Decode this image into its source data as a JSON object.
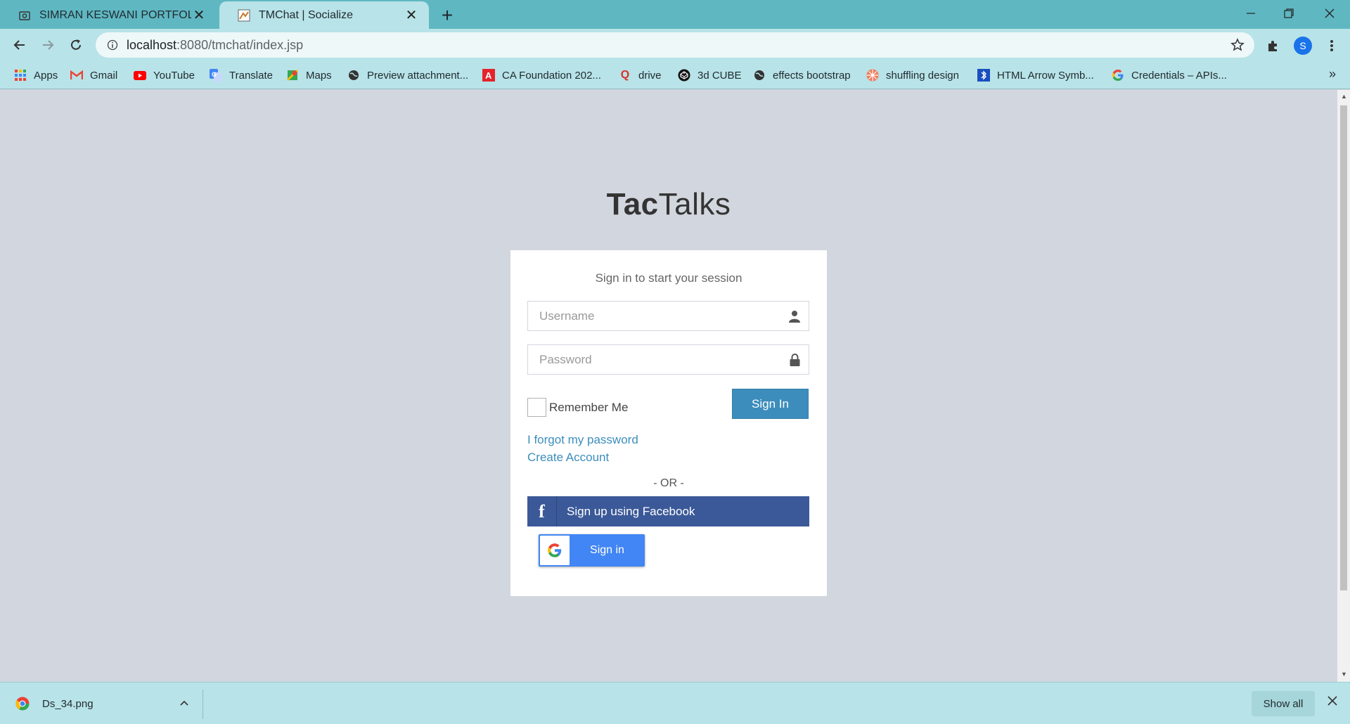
{
  "browser": {
    "tabs": [
      {
        "title": "SIMRAN KESWANI PORTFOLIO",
        "active": false
      },
      {
        "title": "TMChat | Socialize",
        "active": true
      }
    ],
    "url_host": "localhost",
    "url_rest": ":8080/tmchat/index.jsp",
    "profile_initial": "S",
    "bookmarks": [
      {
        "label": "Apps",
        "icon": "apps-grid-icon"
      },
      {
        "label": "Gmail",
        "icon": "gmail-icon"
      },
      {
        "label": "YouTube",
        "icon": "youtube-icon"
      },
      {
        "label": "Translate",
        "icon": "translate-icon"
      },
      {
        "label": "Maps",
        "icon": "maps-icon"
      },
      {
        "label": "Preview attachment...",
        "icon": "globe-icon"
      },
      {
        "label": "CA Foundation 202...",
        "icon": "acrobat-icon"
      },
      {
        "label": "drive",
        "icon": "q-icon"
      },
      {
        "label": "3d CUBE",
        "icon": "codepen-icon"
      },
      {
        "label": "effects bootstrap",
        "icon": "globe-icon"
      },
      {
        "label": "shuffling design",
        "icon": "pinwheel-icon"
      },
      {
        "label": "HTML Arrow Symb...",
        "icon": "bluetooth-icon"
      },
      {
        "label": "Credentials – APIs...",
        "icon": "google-icon"
      }
    ],
    "bookmarks_more": "»"
  },
  "login": {
    "logo_bold": "Tac",
    "logo_light": "Talks",
    "message": "Sign in to start your session",
    "username_placeholder": "Username",
    "password_placeholder": "Password",
    "remember_label": "Remember Me",
    "signin_label": "Sign In",
    "forgot_label": "I forgot my password",
    "create_label": "Create Account",
    "or_label": "- OR -",
    "facebook_label": "Sign up using Facebook",
    "google_label": "Sign in"
  },
  "downloads": {
    "file_name": "Ds_34.png",
    "show_all_label": "Show all"
  }
}
